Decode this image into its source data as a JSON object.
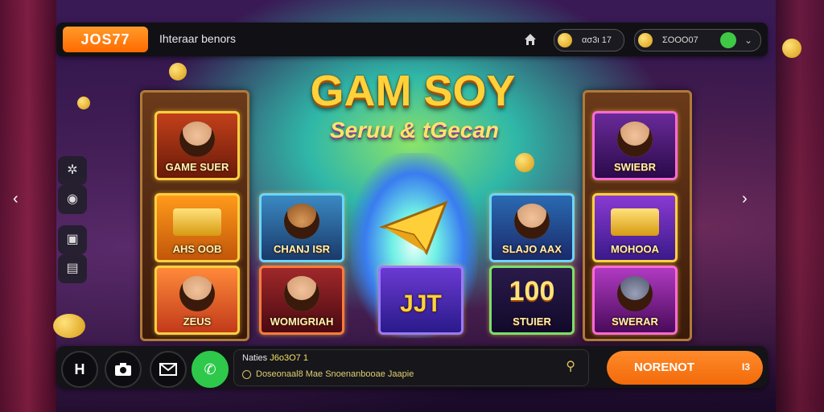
{
  "header": {
    "logo": "JOS77",
    "site_title": "Ihteraar benors",
    "balance1": "ασ3ι 17",
    "balance2": "ΣOOO07"
  },
  "game": {
    "title": "GAM SOY",
    "subtitle": "Seruu & tGecan"
  },
  "tiles": {
    "t1": "GAME SUER",
    "t2": "AHS OOB",
    "t3": "ZEUS",
    "t4": "CHANJ ISR",
    "t5": "WOMIGRIAH",
    "t7": "JJT",
    "t8": "SLAJO AAX",
    "t9_num": "100",
    "t9": "STUIER",
    "t10": "SWIEBR",
    "t11": "MOHOOA",
    "t12": "SWERAR"
  },
  "bottom": {
    "info_key": "Naties",
    "info_val": "J6o3O7 1",
    "info_line2": "Doseonaal8 Mae Snoenanbooae Jaapie",
    "cta_label": "NORENOT",
    "cta_badge": "I3"
  },
  "icons": {
    "home": "home-icon",
    "nav_prev": "chevron-left-icon",
    "nav_next": "chevron-right-icon"
  },
  "colors": {
    "accent": "#ff7a1a",
    "gold": "#ffd23a",
    "green": "#2ec84a"
  }
}
